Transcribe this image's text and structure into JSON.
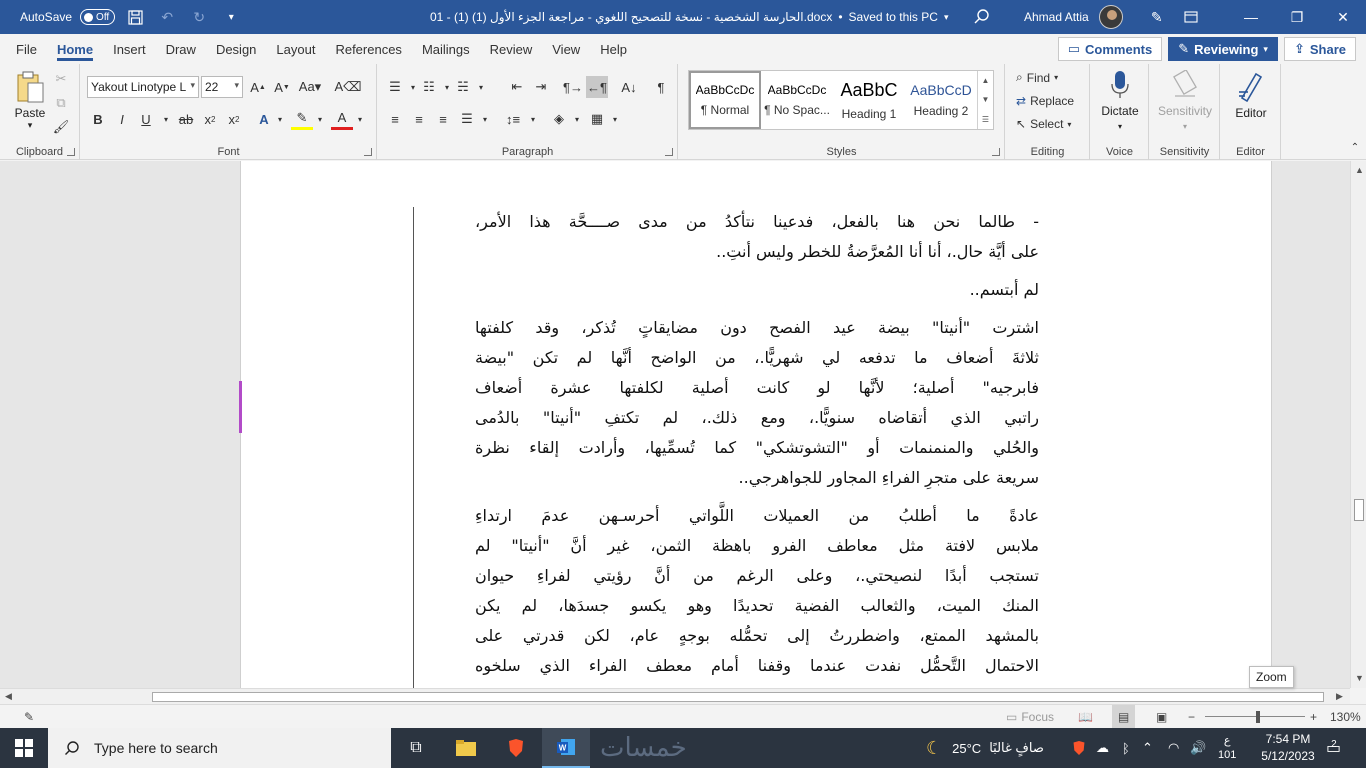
{
  "titlebar": {
    "autosave_label": "AutoSave",
    "autosave_state": "Off",
    "doc_title": "01 - (1) (1) الحارسة الشخصية - نسخة للتصحيح اللغوي - مراجعة الجزء الأول.docx",
    "save_status": "Saved to this PC",
    "user_name": "Ahmad Attia"
  },
  "menu": {
    "tabs": [
      "File",
      "Home",
      "Insert",
      "Draw",
      "Design",
      "Layout",
      "References",
      "Mailings",
      "Review",
      "View",
      "Help"
    ],
    "active_tab": "Home",
    "comments_label": "Comments",
    "reviewing_label": "Reviewing",
    "share_label": "Share"
  },
  "ribbon": {
    "clipboard": {
      "label": "Clipboard",
      "paste_label": "Paste"
    },
    "font": {
      "label": "Font",
      "font_name": "Yakout Linotype L",
      "font_size": "22"
    },
    "paragraph": {
      "label": "Paragraph"
    },
    "styles": {
      "label": "Styles",
      "items": [
        {
          "sample": "AaBbCcDc",
          "name": "¶ Normal"
        },
        {
          "sample": "AaBbCcDc",
          "name": "¶ No Spac..."
        },
        {
          "sample": "AaBbC",
          "name": "Heading 1"
        },
        {
          "sample": "AaBbCcD",
          "name": "Heading 2"
        }
      ]
    },
    "editing": {
      "label": "Editing",
      "find": "Find",
      "replace": "Replace",
      "select": "Select"
    },
    "voice": {
      "label": "Voice",
      "dictate": "Dictate"
    },
    "sensitivity": {
      "label": "Sensitivity",
      "button": "Sensitivity"
    },
    "editor": {
      "label": "Editor",
      "button": "Editor"
    }
  },
  "document": {
    "paragraphs": [
      [
        "- طالما نحن هنا بالفعل، فدعينا نتأكدُ من مدى صــــحَّة هذا الأمر،",
        "على أيَّة حال.، أنا أنا المُعرَّضةُ للخطر وليس أنتِ.."
      ],
      [
        "لم أبتسم.."
      ],
      [
        "اشترت \"أنيتا\" بيضة عيد الفصح دون مضايقاتٍ تُذكر، وقد كلفتها",
        "ثلاثةَ أضعاف ما تدفعه لي شهريًّا.، من الواضح أنَّها لم تكن \"بيضة",
        "فابرجيه\" أصلية؛ لأنَّها لو كانت أصلية لكلفتها عشرة أضعاف",
        "راتبي الذي أتقاضاه سنويًّا.، ومع ذلك.، لم تكتفِ \"أنيتا\" بالدُمى",
        "والحُلي والمنمنمات أو \"التشوتشكي\" كما تُسمِّيها، وأرادت إلقاء نظرة",
        "سريعة على متجرِ الفراءِ المجاور للجواهرجي.."
      ],
      [
        "عادةً ما أطلبُ من العميلات اللَّواتي أحرسـهن عدمَ ارتداءِ",
        "ملابس لافتة مثل معاطف الفرو باهظة الثمن، غير أنَّ \"أنيتا\" لم",
        "تستجب أبدًا لنصيحتي.، وعلى الرغم من أنَّ رؤيتي لفراءِ حيوان",
        "المنك الميت، والثعالب الفضية تحديدًا وهو يكسو جسدَها، لم يكن",
        "بالمشهد الممتع، واضطررتُ إلى تحمُّله بوجهٍ عام، لكن قدرتي على",
        "الاحتمال التَّحمُّل نفدت عندما وقفنا أمام معطف الفراء الذي سلخوه"
      ]
    ]
  },
  "tooltip": {
    "zoom": "Zoom"
  },
  "statusbar": {
    "focus_label": "Focus",
    "zoom_level": "130%"
  },
  "taskbar": {
    "search_placeholder": "Type here to search",
    "watermark": "خمسات",
    "temperature": "25°C",
    "weather_desc": "صافٍ غالبًا",
    "lang_line1": "ع",
    "lang_line2": "101",
    "time": "7:54 PM",
    "date": "5/12/2023",
    "notifications": "2"
  },
  "colors": {
    "accent": "#2b579a",
    "highlight": "#ffff00",
    "change_bar": "#b24bc8"
  }
}
